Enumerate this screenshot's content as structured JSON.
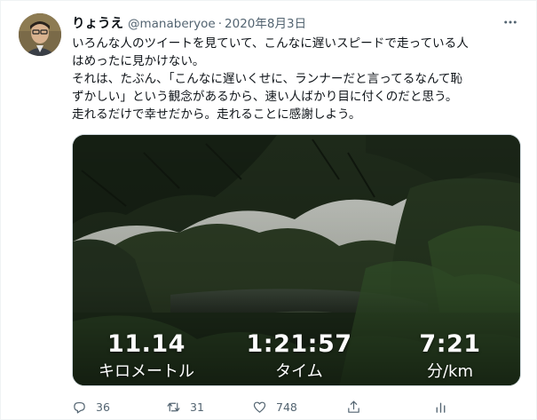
{
  "tweet": {
    "display_name": "りょうえ",
    "handle": "@manaberyoe",
    "separator": "·",
    "date": "2020年8月3日",
    "body_lines": [
      "いろんな人のツイートを見ていて、こんなに遅いスピードで走っている人",
      "はめったに見かけない。",
      "それは、たぶん、「こんなに遅いくせに、ランナーだと言ってるなんて恥",
      "ずかしい」という観念があるから、速い人ばかり目に付くのだと思う。",
      "走れるだけで幸せだから。走れることに感謝しよう。"
    ]
  },
  "media": {
    "stats": [
      {
        "value": "11.14",
        "unit": "キロメートル"
      },
      {
        "value": "1:21:57",
        "unit": "タイム"
      },
      {
        "value": "7:21",
        "unit": "分/km"
      }
    ]
  },
  "actions": {
    "reply_count": "36",
    "retweet_count": "31",
    "like_count": "748",
    "share_label": "",
    "reply_icon": "reply-icon",
    "retweet_icon": "retweet-icon",
    "like_icon": "heart-icon",
    "share_icon": "share-icon",
    "stats_icon": "stats-icon"
  },
  "colors": {
    "text_primary": "#0f1419",
    "text_secondary": "#536471",
    "border": "#cfd9de"
  }
}
